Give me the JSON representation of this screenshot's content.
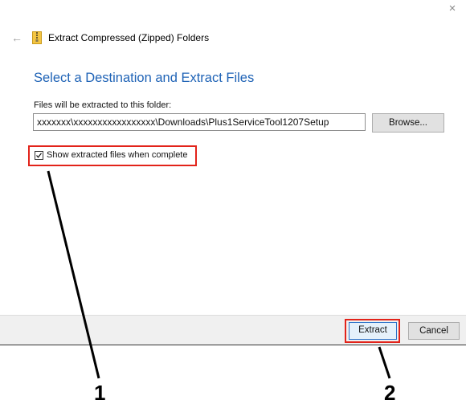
{
  "window": {
    "title": "Extract Compressed (Zipped) Folders",
    "close_glyph": "×",
    "back_glyph": "←"
  },
  "main": {
    "heading": "Select a Destination and Extract Files",
    "path_label": "Files will be extracted to this folder:",
    "path_value": "xxxxxxx\\xxxxxxxxxxxxxxxxx\\Downloads\\Plus1ServiceTool1207Setup",
    "browse_label": "Browse...",
    "show_files_checkbox": {
      "label": "Show extracted files when complete",
      "checked": true
    }
  },
  "footer": {
    "extract_label": "Extract",
    "cancel_label": "Cancel"
  },
  "callouts": {
    "one": "1",
    "two": "2"
  },
  "colors": {
    "accent": "#1f63b6",
    "highlight": "#e2231a"
  },
  "icons": [
    "close-icon",
    "back-arrow-icon",
    "zip-folder-icon",
    "checkmark-icon"
  ]
}
